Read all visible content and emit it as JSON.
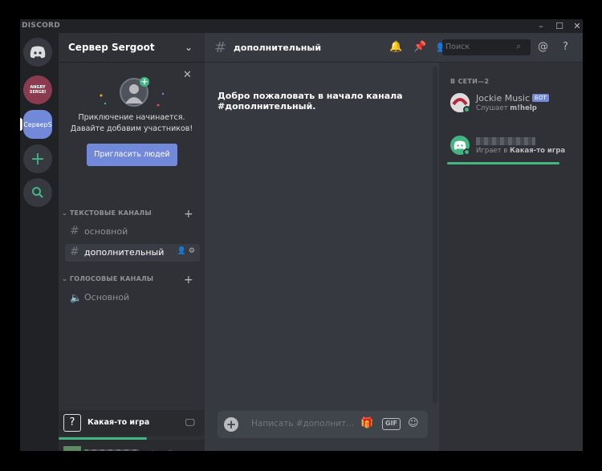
{
  "window": {
    "brand": "DISCORD",
    "controls": [
      "–",
      "☐",
      "✕"
    ]
  },
  "servers": {
    "avatar_label": "ANGRY\nSERGEI",
    "current_label": "СерверS"
  },
  "sidebar": {
    "server_name": "Сервер Sergoot",
    "invite": {
      "line1": "Приключение начинается.",
      "line2": "Давайте добавим участников!",
      "button": "Пригласить людей"
    },
    "categories": [
      {
        "label": "ТЕКСТОВЫЕ КАНАЛЫ"
      },
      {
        "label": "ГОЛОСОВЫЕ КАНАЛЫ"
      }
    ],
    "channels": {
      "text": [
        "основной",
        "дополнительный"
      ],
      "voice": [
        "Основной"
      ]
    },
    "activity": {
      "game": "Какая-то игра"
    }
  },
  "main": {
    "channel_name": "дополнительный",
    "search_placeholder": "Поиск",
    "welcome_line1": "Добро пожаловать в начало канала",
    "welcome_line2": "#дополнительный",
    "welcome_dot": ".",
    "composer_placeholder": "Написать #дополнит...",
    "gif_label": "GIF"
  },
  "members": {
    "category": "В СЕТИ—2",
    "list": [
      {
        "name": "Jockie Music",
        "badge": "БОТ",
        "status_prefix": "Слушает",
        "status_value": "m!help"
      },
      {
        "status_prefix": "Играет в",
        "status_value": "Какая-то игра"
      }
    ]
  },
  "colors": {
    "accent": "#7289da",
    "online": "#43b581",
    "background": "#36393f",
    "sidebar": "#2f3136",
    "rail": "#202225"
  }
}
